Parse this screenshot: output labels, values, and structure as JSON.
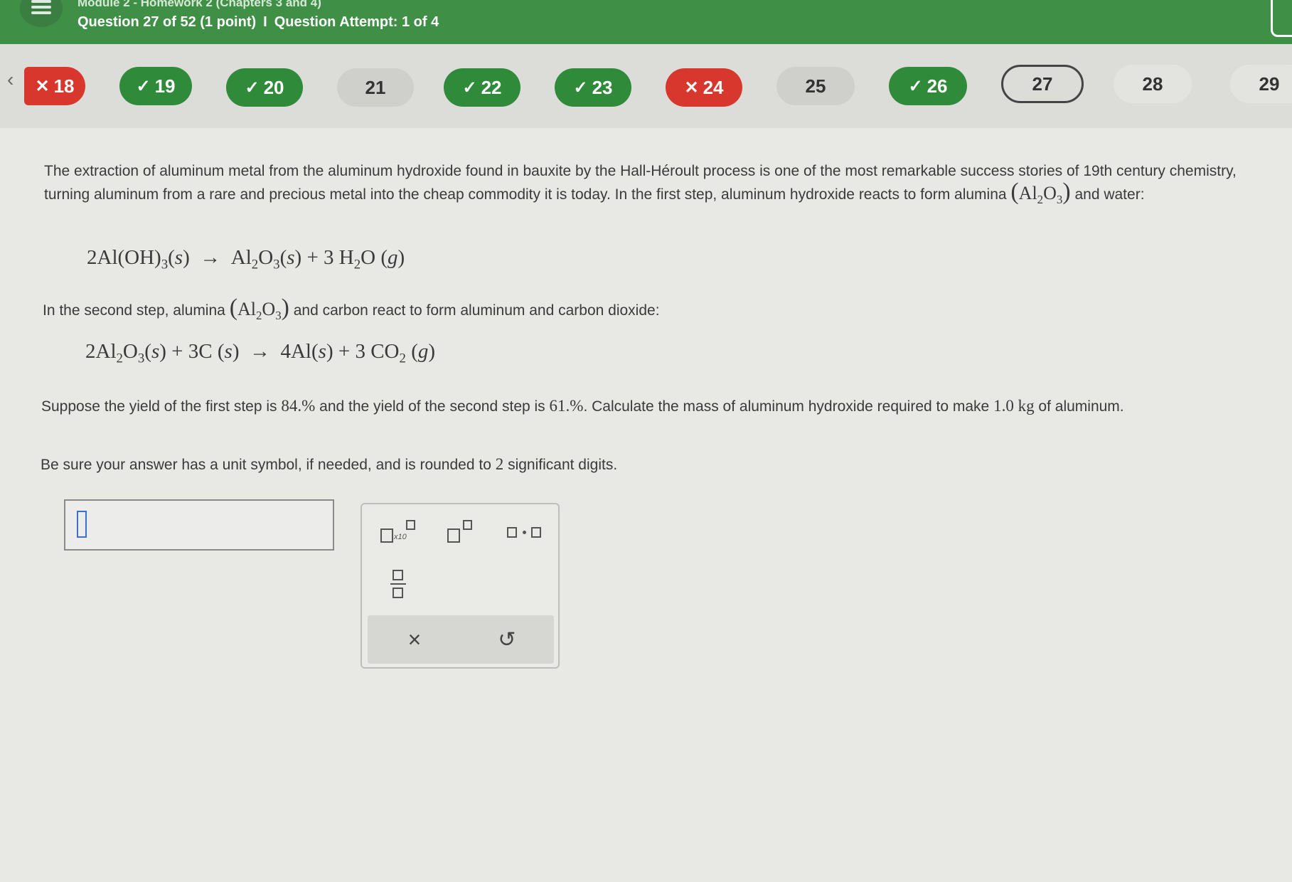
{
  "header": {
    "breadcrumb": "Module 2 - Homework 2 (Chapters 3 and 4)",
    "question_label": "Question 27 of 52 (1 point)",
    "separator": "I",
    "attempt_label": "Question Attempt: 1 of 4"
  },
  "nav": {
    "prev_icon": "‹",
    "questions": [
      {
        "num": "18",
        "status": "wrong",
        "mark": "✕"
      },
      {
        "num": "19",
        "status": "correct",
        "mark": "✓"
      },
      {
        "num": "20",
        "status": "correct",
        "mark": "✓"
      },
      {
        "num": "21",
        "status": "open",
        "mark": ""
      },
      {
        "num": "22",
        "status": "correct",
        "mark": "✓"
      },
      {
        "num": "23",
        "status": "correct",
        "mark": "✓"
      },
      {
        "num": "24",
        "status": "wrong",
        "mark": "✕"
      },
      {
        "num": "25",
        "status": "open",
        "mark": ""
      },
      {
        "num": "26",
        "status": "correct",
        "mark": "✓"
      },
      {
        "num": "27",
        "status": "current",
        "mark": ""
      },
      {
        "num": "28",
        "status": "plain",
        "mark": ""
      },
      {
        "num": "29",
        "status": "plain",
        "mark": ""
      }
    ],
    "colors": {
      "correct": "#2f8a3a",
      "wrong": "#d7372c"
    }
  },
  "problem": {
    "intro": "The extraction of aluminum metal from the aluminum hydroxide found in bauxite by the Hall-Héroult process is one of the most remarkable success stories of 19th century chemistry, turning aluminum from a rare and precious metal into the cheap commodity it is today. In the first step, aluminum hydroxide reacts to form alumina",
    "intro_tail": "and water:",
    "step2_lead": "In the second step, alumina",
    "step2_tail": "and carbon react to form aluminum and carbon dioxide:",
    "yield_a": "Suppose the yield of the first step is",
    "yield1": "84.%",
    "yield_b": "and the yield of the second step is",
    "yield2": "61.%",
    "yield_c": ". Calculate the mass of aluminum hydroxide required to make",
    "mass": "1.0 kg",
    "yield_d": "of aluminum.",
    "instr_a": "Be sure your answer has a unit symbol, if needed, and is rounded to",
    "sig_digits": "2",
    "instr_b": "significant digits."
  },
  "answer": {
    "value": ""
  },
  "tools": {
    "sci_notation_label": "x10",
    "clear_icon": "×",
    "undo_icon": "↺"
  }
}
